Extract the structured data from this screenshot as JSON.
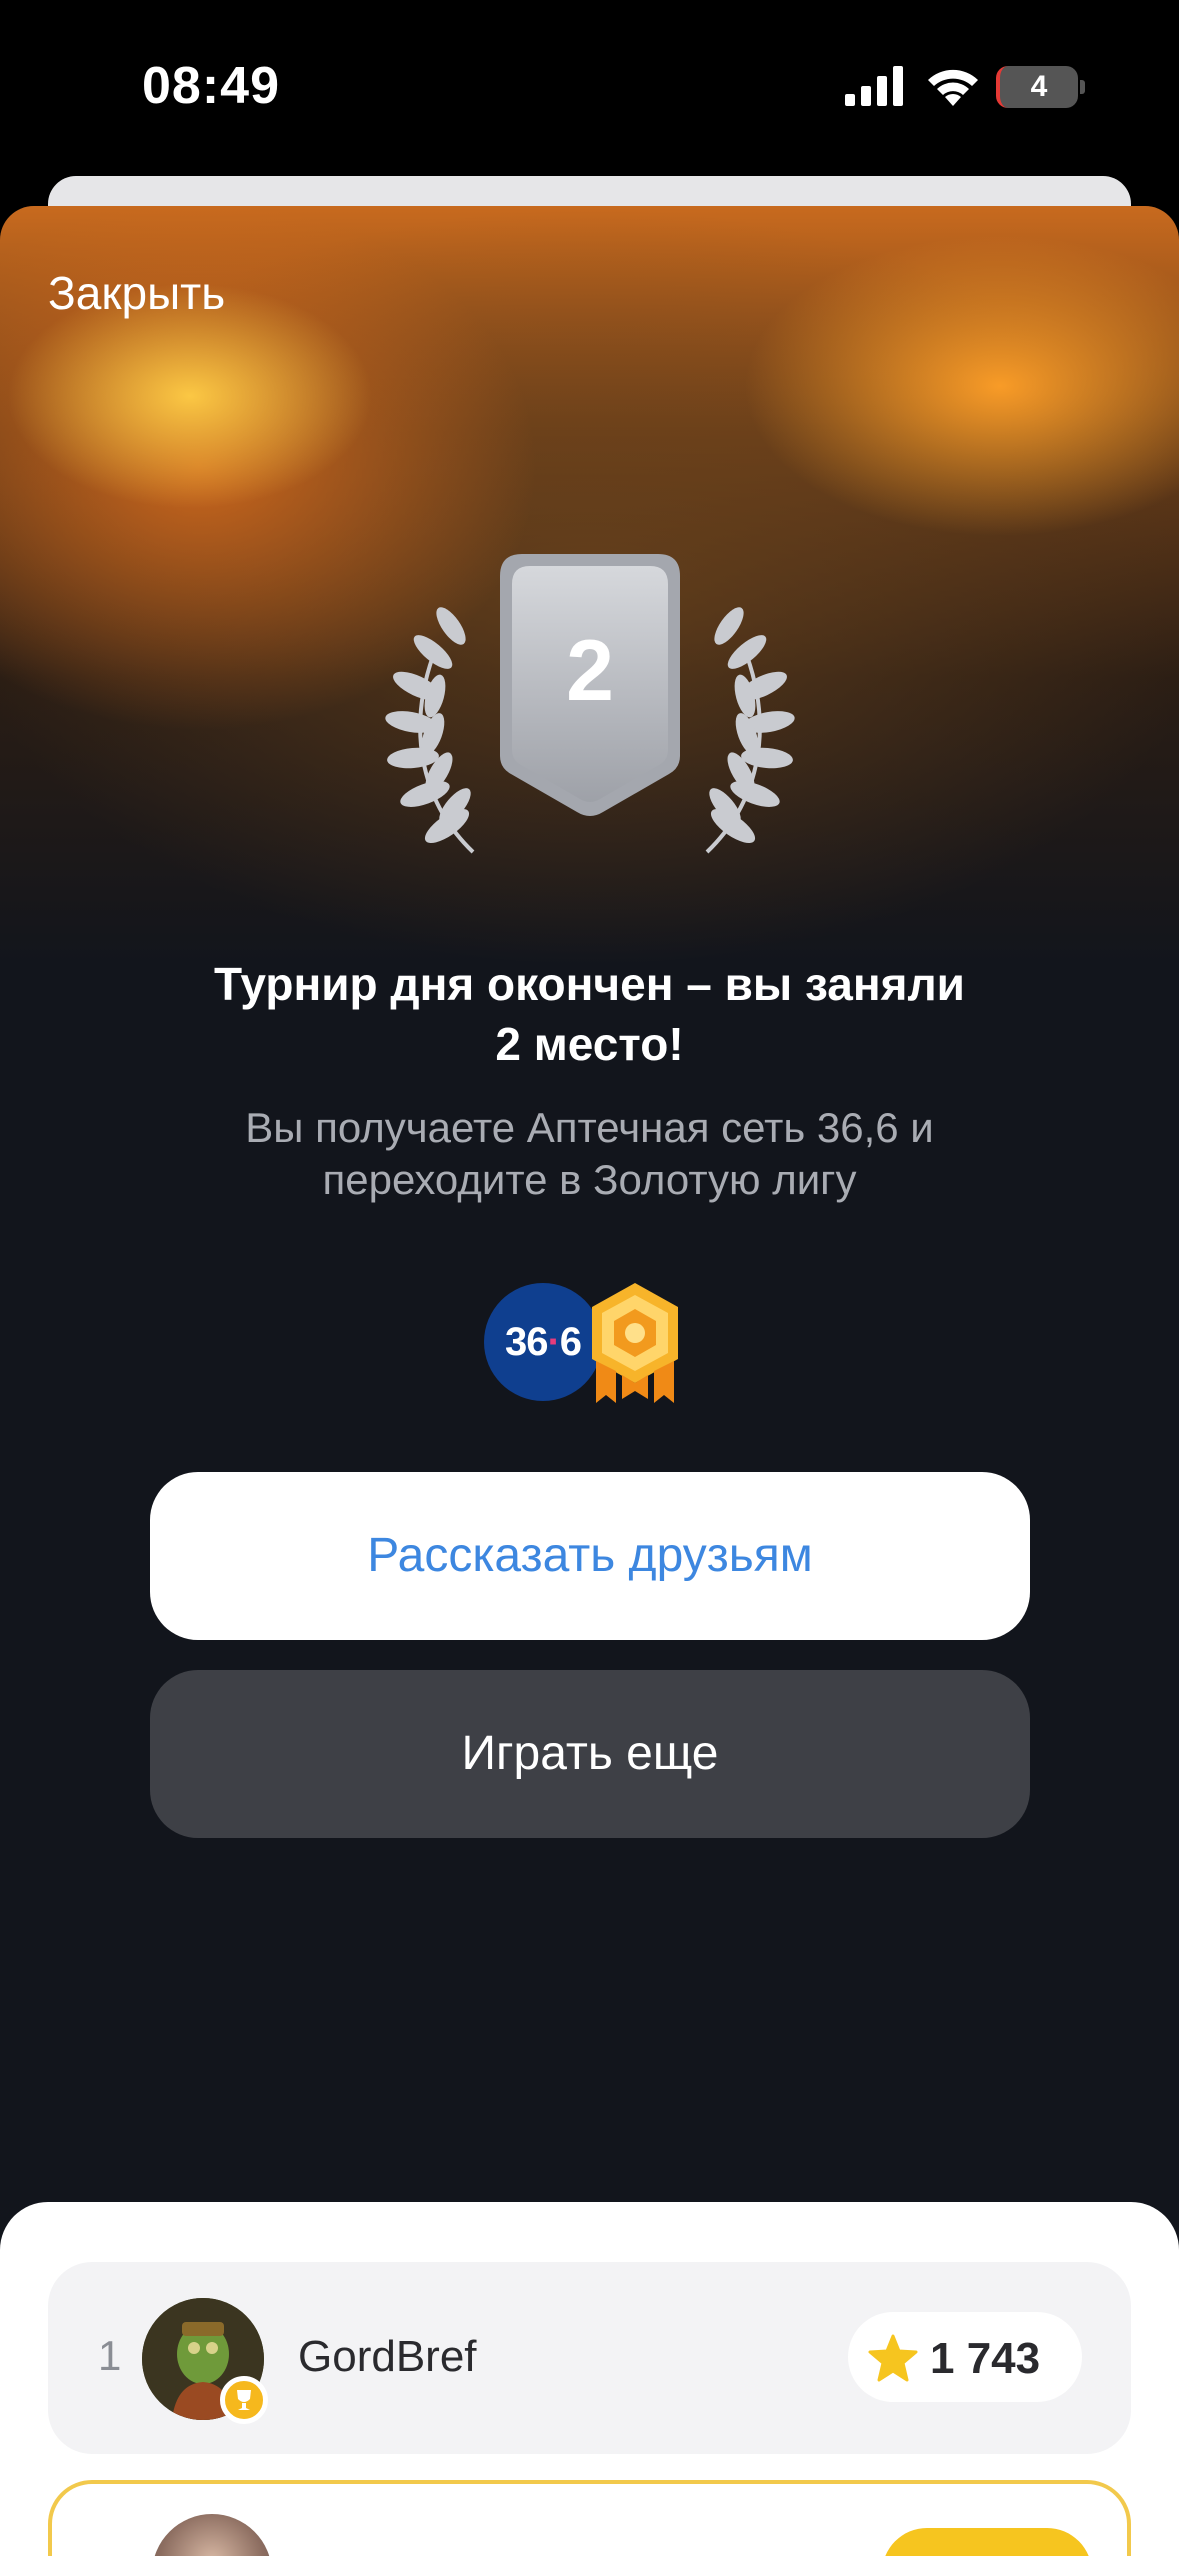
{
  "status_bar": {
    "time": "08:49",
    "battery": "4"
  },
  "modal": {
    "close_label": "Закрыть",
    "place_number": "2",
    "title_line1": "Турнир дня окончен – вы заняли",
    "title_line2": "2 место!",
    "subtitle_line1": "Вы получаете Аптечная сеть 36,6 и",
    "subtitle_line2": "переходите в Золотую лигу",
    "pharmacy_logo": {
      "main": "36",
      "dot": "·",
      "tail": "6"
    },
    "share_button": "Рассказать друзьям",
    "play_again_button": "Играть еще"
  },
  "leaderboard": {
    "rows": [
      {
        "rank": "1",
        "name": "GordBref",
        "score": "1 743"
      }
    ]
  },
  "colors": {
    "accent_blue": "#3d87e0",
    "gold": "#f6c51f",
    "modal_bg": "#12151c"
  }
}
